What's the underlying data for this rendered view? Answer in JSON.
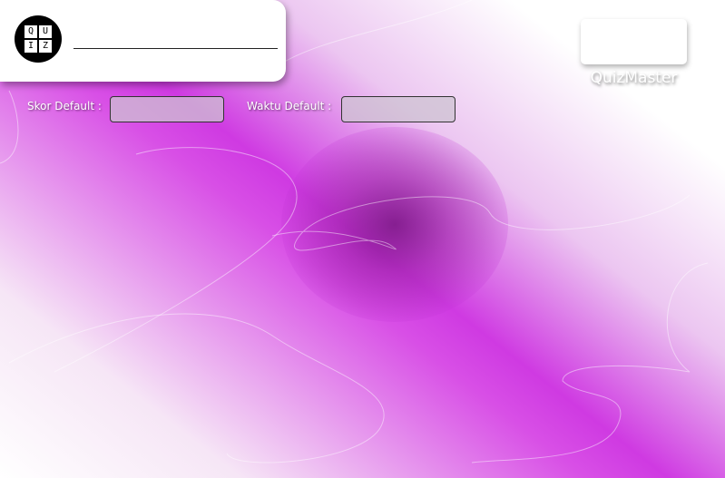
{
  "header": {
    "logo": {
      "icon": "quiz-logo-icon",
      "letters": [
        "Q",
        "U",
        "I",
        "Z"
      ]
    },
    "title_value": ""
  },
  "brand": {
    "button_label": "",
    "name": "QuizMaster"
  },
  "settings": {
    "score_label": "Skor Default :",
    "score_value": "",
    "time_label": "Waktu Default :",
    "time_value": ""
  },
  "colors": {
    "background_accent": "#cf3ae2",
    "background_light": "#ffffff",
    "field_background": "#cdc3d2"
  }
}
